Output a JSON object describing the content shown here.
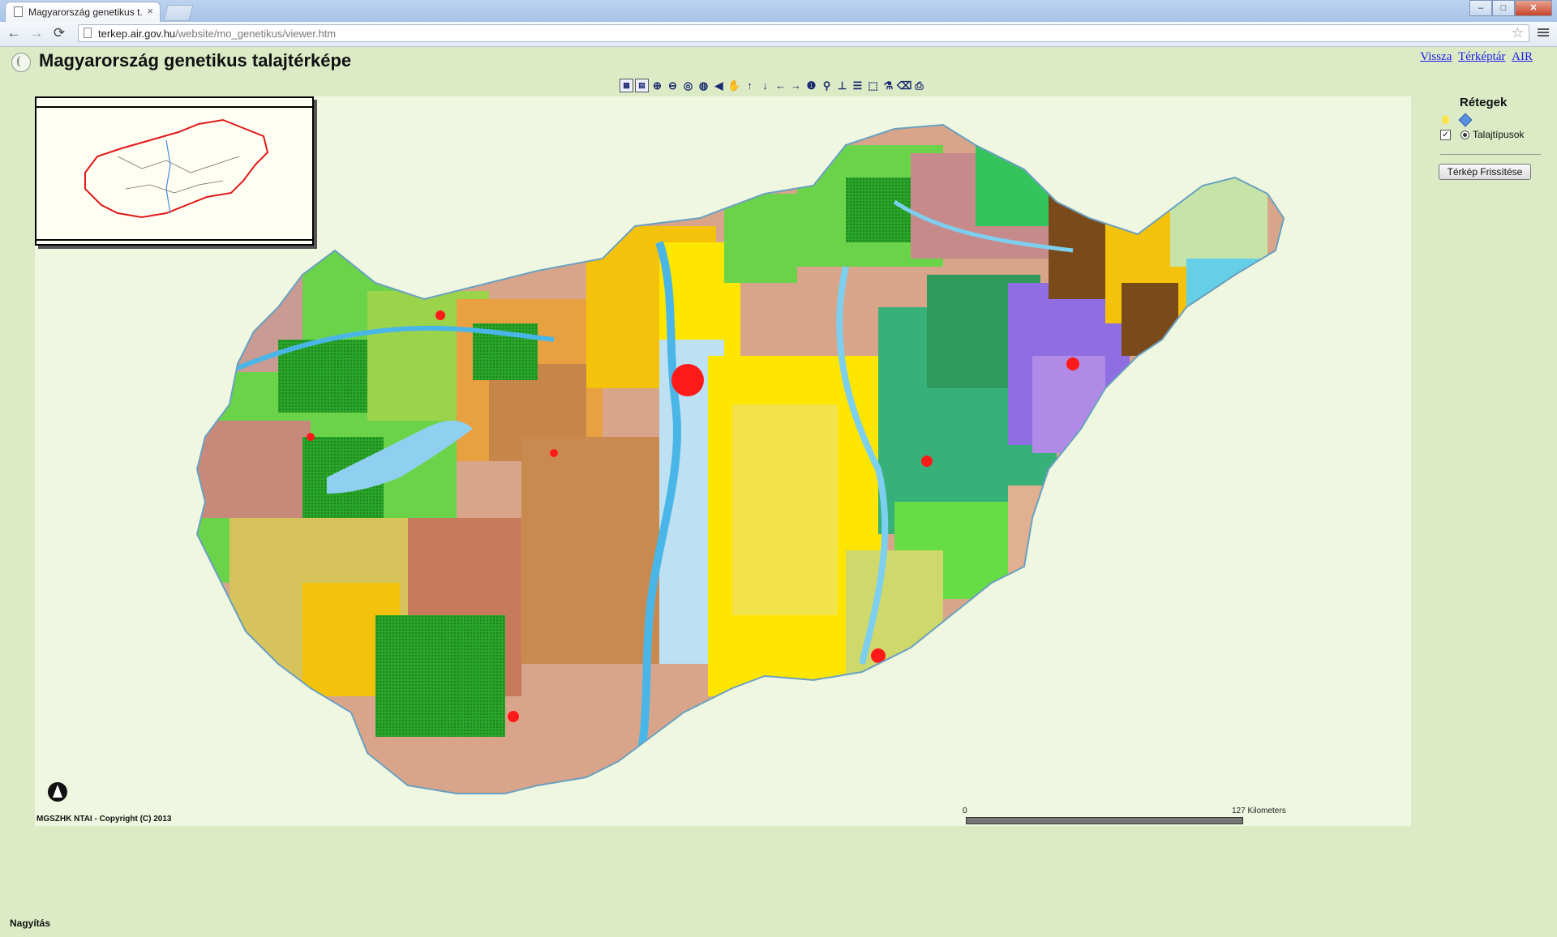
{
  "browser": {
    "tab_title": "Magyarország genetikus t...",
    "tab_close": "×",
    "url_host": "terkep.air.gov.hu",
    "url_path": "/website/mo_genetikus/viewer.htm",
    "back_glyph": "←",
    "forward_glyph": "→",
    "reload_glyph": "⟳",
    "star_glyph": "☆",
    "win_min": "–",
    "win_max": "□",
    "win_close": "✕"
  },
  "page": {
    "title": "Magyarország genetikus talajtérképe",
    "links": [
      "Vissza",
      "Térképtár",
      "AIR"
    ]
  },
  "map": {
    "copyright": "MGSZHK NTAI - Copyright (C) 2013",
    "scale_start": "0",
    "scale_end": "127 Kilometers"
  },
  "toolbar": {
    "tools": [
      {
        "name": "legend-toggle-icon",
        "glyph": "▦"
      },
      {
        "name": "overview-toggle-icon",
        "glyph": "▤"
      },
      {
        "name": "zoom-in-icon",
        "glyph": "⊕"
      },
      {
        "name": "zoom-out-icon",
        "glyph": "⊖"
      },
      {
        "name": "full-extent-icon",
        "glyph": "◎"
      },
      {
        "name": "zoom-active-icon",
        "glyph": "◍"
      },
      {
        "name": "zoom-back-icon",
        "glyph": "◀"
      },
      {
        "name": "pan-hand-icon",
        "glyph": "✋"
      },
      {
        "name": "pan-north-icon",
        "glyph": "↑"
      },
      {
        "name": "pan-south-icon",
        "glyph": "↓"
      },
      {
        "name": "pan-west-icon",
        "glyph": "←"
      },
      {
        "name": "pan-east-icon",
        "glyph": "→"
      },
      {
        "name": "identify-icon",
        "glyph": "❶"
      },
      {
        "name": "find-binoculars-icon",
        "glyph": "⚲"
      },
      {
        "name": "measure-icon",
        "glyph": "⊥"
      },
      {
        "name": "set-units-icon",
        "glyph": "☰"
      },
      {
        "name": "select-rectangle-icon",
        "glyph": "⬚"
      },
      {
        "name": "query-icon",
        "glyph": "⚗"
      },
      {
        "name": "clear-selection-icon",
        "glyph": "⌫"
      },
      {
        "name": "print-icon",
        "glyph": "⎙"
      }
    ]
  },
  "layers": {
    "title": "Rétegek",
    "items": [
      {
        "label": "Talajtípusok",
        "checked": true,
        "active": true
      }
    ],
    "check_glyph": "✓",
    "refresh_label": "Térkép Frissítése"
  },
  "status": {
    "text": "Nagyítás"
  },
  "colors": {
    "page_bg": "#dcebc6",
    "map_bg": "#eff7e0",
    "link": "#1a1aee",
    "overview_border": "#e01818"
  }
}
